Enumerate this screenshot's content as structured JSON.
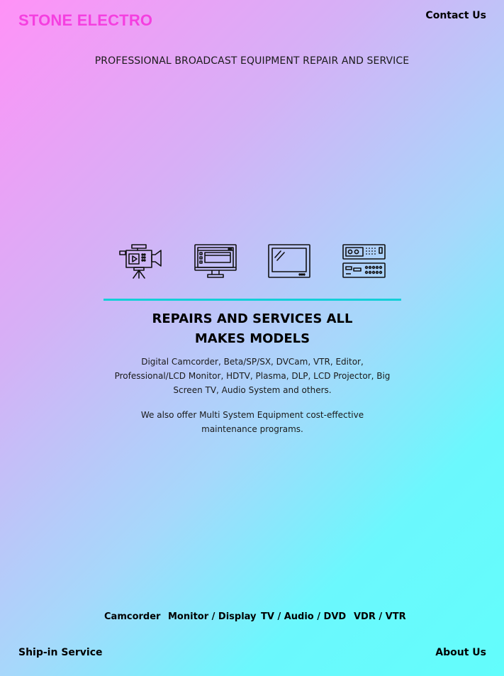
{
  "header": {
    "brand": "STONE ELECTRO",
    "contact_link": "Contact Us",
    "tagline": "PROFESSIONAL BROADCAST EQUIPMENT REPAIR AND SERVICE"
  },
  "icons": [
    {
      "name": "video-camera-icon"
    },
    {
      "name": "computer-monitor-icon"
    },
    {
      "name": "television-icon"
    },
    {
      "name": "vcr-deck-icon"
    }
  ],
  "colors": {
    "brand": "#f53fe0",
    "divider": "#14cfd8",
    "gradient_start": "#ff92f7",
    "gradient_end": "#62fdfc"
  },
  "main": {
    "heading": "REPAIRS AND SERVICES ALL MAKES MODELS",
    "paragraph1": "Digital Camcorder, Beta/SP/SX, DVCam, VTR, Editor, Professional/LCD Monitor, HDTV, Plasma, DLP, LCD Projector, Big Screen TV, Audio System and others.",
    "paragraph2": "We also offer Multi System Equipment cost-effective maintenance programs."
  },
  "category_nav": [
    "Camcorder",
    "Monitor / Display",
    "TV / Audio / DVD",
    "VDR / VTR"
  ],
  "footer": {
    "left_link": "Ship-in Service",
    "right_link": "About Us"
  }
}
